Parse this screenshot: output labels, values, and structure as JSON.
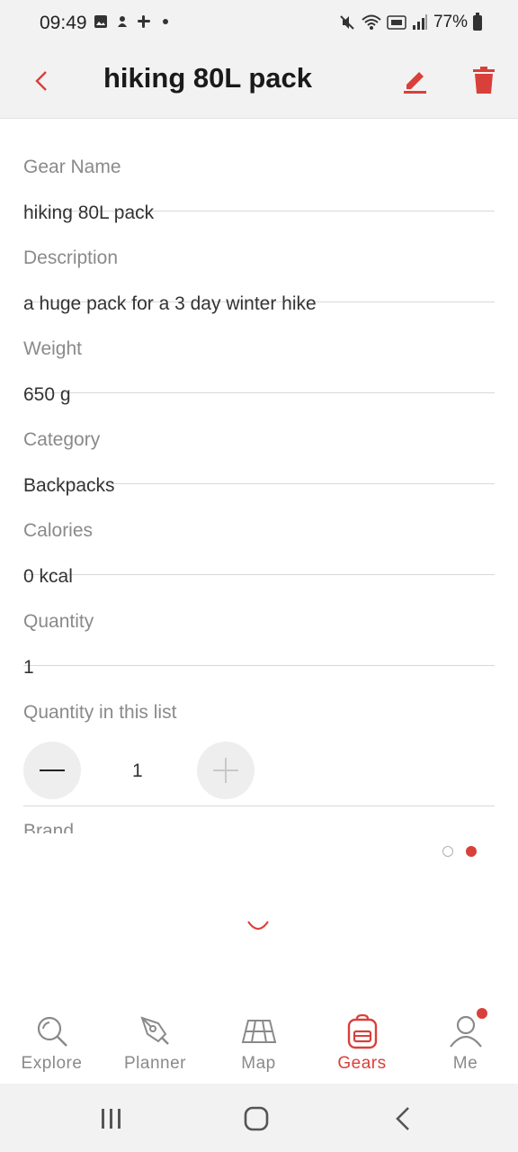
{
  "status_bar": {
    "time": "09:49",
    "battery_text": "77%",
    "icons": [
      "image-icon",
      "notification-icon",
      "slack-icon",
      "dot-icon",
      "mute-icon",
      "wifi-icon",
      "volte-icon",
      "signal-icon",
      "battery-icon"
    ]
  },
  "app_bar": {
    "title": "hiking 80L pack",
    "icons": [
      "back-chevron-icon",
      "edit-pencil-icon",
      "trash-icon"
    ]
  },
  "fields": [
    {
      "label": "Gear Name",
      "value": "hiking 80L pack"
    },
    {
      "label": "Description",
      "value": "a huge pack for a 3 day winter hike"
    },
    {
      "label": "Weight",
      "value": "650 g"
    },
    {
      "label": "Category",
      "value": "Backpacks"
    },
    {
      "label": "Calories",
      "value": "0 kcal"
    },
    {
      "label": "Quantity",
      "value": "1"
    }
  ],
  "quantity_in_list": {
    "label": "Quantity in this list",
    "value": "1",
    "icons": [
      "minus-icon",
      "plus-icon"
    ]
  },
  "brand": {
    "label": "Brand"
  },
  "pager": {
    "count": 2,
    "active_index": 1
  },
  "bottom_nav": {
    "items": [
      {
        "label": "Explore",
        "icon": "search-icon"
      },
      {
        "label": "Planner",
        "icon": "pen-nib-icon"
      },
      {
        "label": "Map",
        "icon": "map-icon"
      },
      {
        "label": "Gears",
        "icon": "backpack-icon",
        "active": true
      },
      {
        "label": "Me",
        "icon": "user-icon",
        "badge": true
      }
    ]
  },
  "colors": {
    "accent": "#d9403a",
    "label_gray": "#8a8a8a",
    "text": "#333333",
    "bar_bg": "#f2f2f2"
  }
}
